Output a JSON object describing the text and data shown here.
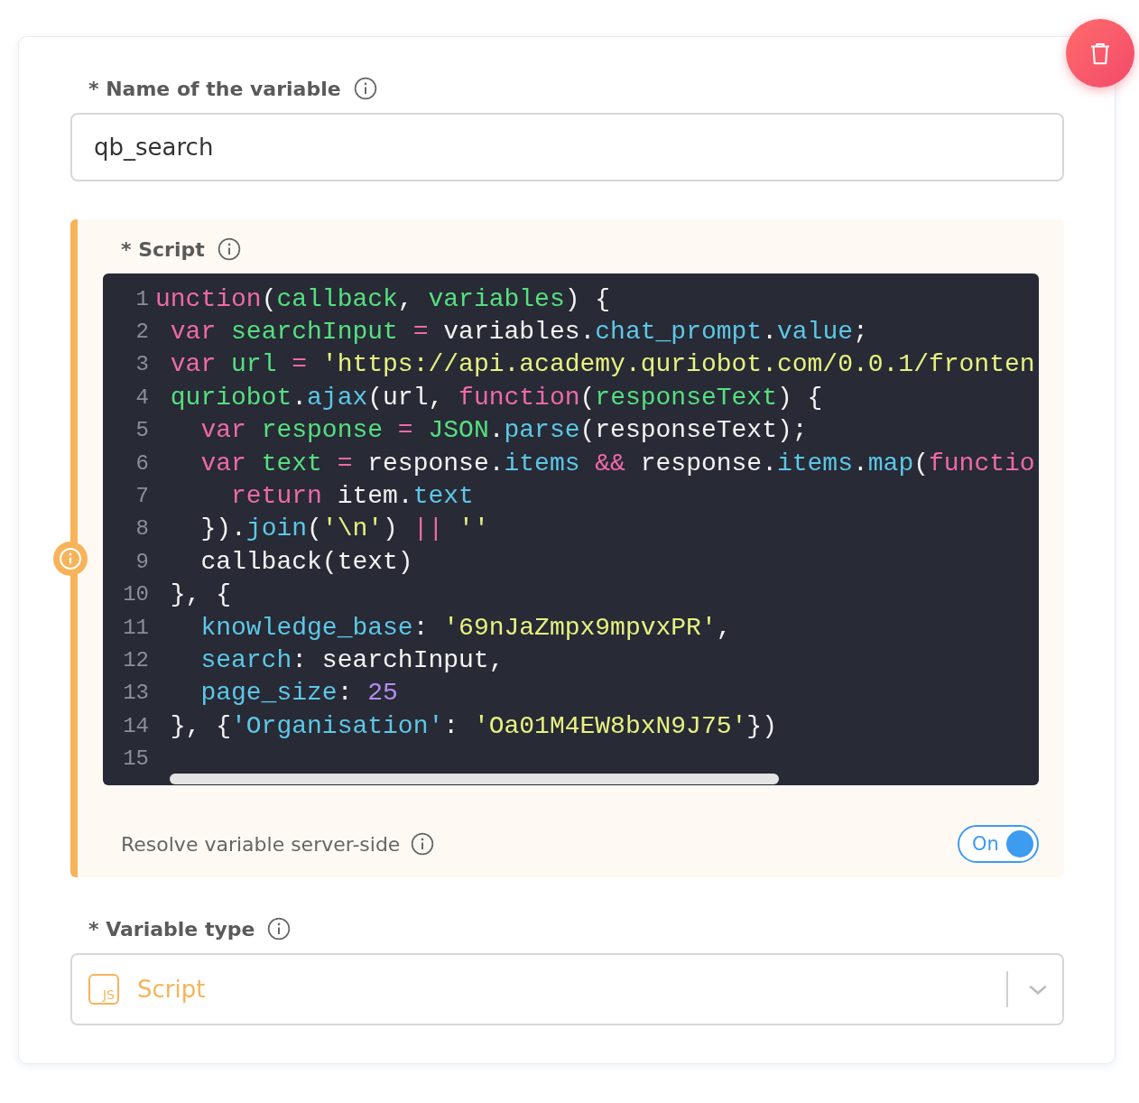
{
  "name_field": {
    "label": "* Name of the variable",
    "value": "qb_search"
  },
  "script": {
    "label": "* Script",
    "lines": [
      {
        "number": "1",
        "tokens": [
          {
            "kind": "keyword",
            "text": "unction"
          },
          {
            "kind": "plain",
            "text": "("
          },
          {
            "kind": "name",
            "text": "callback"
          },
          {
            "kind": "plain",
            "text": ","
          },
          {
            "kind": "name",
            "text": " variables"
          },
          {
            "kind": "plain",
            "text": ") {"
          }
        ]
      },
      {
        "number": "2",
        "tokens": [
          {
            "kind": "keyword",
            "text": " var"
          },
          {
            "kind": "name",
            "text": " searchInput"
          },
          {
            "kind": "keyword",
            "text": " ="
          },
          {
            "kind": "plain",
            "text": " variables."
          },
          {
            "kind": "prop",
            "text": "chat_prompt"
          },
          {
            "kind": "plain",
            "text": "."
          },
          {
            "kind": "prop",
            "text": "value"
          },
          {
            "kind": "plain",
            "text": ";"
          }
        ]
      },
      {
        "number": "3",
        "tokens": [
          {
            "kind": "keyword",
            "text": " var"
          },
          {
            "kind": "name",
            "text": " url"
          },
          {
            "kind": "keyword",
            "text": " ="
          },
          {
            "kind": "string",
            "text": " 'https://api.academy.quriobot.com/0.0.1/fronten"
          }
        ]
      },
      {
        "number": "4",
        "tokens": [
          {
            "kind": "name",
            "text": " quriobot"
          },
          {
            "kind": "plain",
            "text": "."
          },
          {
            "kind": "prop",
            "text": "ajax"
          },
          {
            "kind": "plain",
            "text": "(url,"
          },
          {
            "kind": "keyword",
            "text": " function"
          },
          {
            "kind": "plain",
            "text": "("
          },
          {
            "kind": "name",
            "text": "responseText"
          },
          {
            "kind": "plain",
            "text": ") {"
          }
        ]
      },
      {
        "number": "5",
        "tokens": [
          {
            "kind": "keyword",
            "text": "   var"
          },
          {
            "kind": "name",
            "text": " response"
          },
          {
            "kind": "keyword",
            "text": " ="
          },
          {
            "kind": "name",
            "text": " JSON"
          },
          {
            "kind": "plain",
            "text": "."
          },
          {
            "kind": "prop",
            "text": "parse"
          },
          {
            "kind": "plain",
            "text": "(responseText);"
          }
        ]
      },
      {
        "number": "6",
        "tokens": [
          {
            "kind": "keyword",
            "text": "   var"
          },
          {
            "kind": "name",
            "text": " text"
          },
          {
            "kind": "keyword",
            "text": " ="
          },
          {
            "kind": "plain",
            "text": " response."
          },
          {
            "kind": "prop",
            "text": "items"
          },
          {
            "kind": "keyword",
            "text": " &&"
          },
          {
            "kind": "plain",
            "text": " response."
          },
          {
            "kind": "prop",
            "text": "items"
          },
          {
            "kind": "plain",
            "text": "."
          },
          {
            "kind": "prop",
            "text": "map"
          },
          {
            "kind": "plain",
            "text": "("
          },
          {
            "kind": "keyword",
            "text": "functio"
          }
        ]
      },
      {
        "number": "7",
        "tokens": [
          {
            "kind": "keyword",
            "text": "     return"
          },
          {
            "kind": "plain",
            "text": " item."
          },
          {
            "kind": "prop",
            "text": "text"
          }
        ]
      },
      {
        "number": "8",
        "tokens": [
          {
            "kind": "plain",
            "text": "   })."
          },
          {
            "kind": "prop",
            "text": "join"
          },
          {
            "kind": "plain",
            "text": "("
          },
          {
            "kind": "string",
            "text": "'\\n'"
          },
          {
            "kind": "plain",
            "text": ")"
          },
          {
            "kind": "keyword",
            "text": " ||"
          },
          {
            "kind": "string",
            "text": " ''"
          }
        ]
      },
      {
        "number": "9",
        "tokens": [
          {
            "kind": "plain",
            "text": "   callback(text)"
          }
        ]
      },
      {
        "number": "10",
        "tokens": [
          {
            "kind": "plain",
            "text": " }, {"
          }
        ]
      },
      {
        "number": "11",
        "tokens": [
          {
            "kind": "prop",
            "text": "   knowledge_base"
          },
          {
            "kind": "plain",
            "text": ":"
          },
          {
            "kind": "string",
            "text": " '69nJaZmpx9mpvxPR'"
          },
          {
            "kind": "plain",
            "text": ","
          }
        ]
      },
      {
        "number": "12",
        "tokens": [
          {
            "kind": "prop",
            "text": "   search"
          },
          {
            "kind": "plain",
            "text": ": searchInput,"
          }
        ]
      },
      {
        "number": "13",
        "tokens": [
          {
            "kind": "prop",
            "text": "   page_size"
          },
          {
            "kind": "plain",
            "text": ":"
          },
          {
            "kind": "number",
            "text": " 25"
          }
        ]
      },
      {
        "number": "14",
        "tokens": [
          {
            "kind": "plain",
            "text": " }, {"
          },
          {
            "kind": "prop",
            "text": "'Organisation'"
          },
          {
            "kind": "plain",
            "text": ":"
          },
          {
            "kind": "string",
            "text": " 'Oa01M4EW8bxN9J75'"
          },
          {
            "kind": "plain",
            "text": "})"
          }
        ]
      },
      {
        "number": "15"
      }
    ],
    "server_side": {
      "label": "Resolve variable server-side",
      "toggle": {
        "label": "On",
        "on": true
      }
    }
  },
  "type_field": {
    "label": "* Variable type",
    "icon_text": "JS",
    "value": "Script"
  }
}
